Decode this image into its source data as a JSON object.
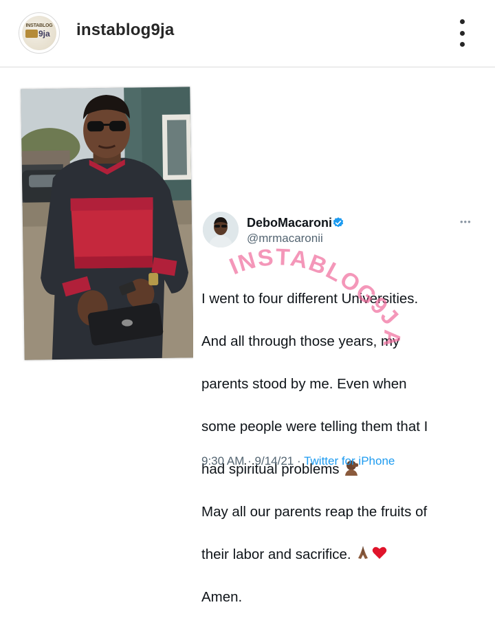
{
  "header": {
    "username": "instablog9ja",
    "avatar_logo_top": "INSTABLOG",
    "avatar_logo_num": "9ja",
    "more_icon": "more-vertical-icon"
  },
  "tweet": {
    "name": "DeboMacaroni",
    "handle": "@mrmacaronii",
    "verified_icon": "verified-badge-icon",
    "body_lines": [
      "I went to four different Universities.",
      "And all through those years, my",
      "parents stood by me. Even when",
      "some people were telling them that I",
      "had spiritual problems",
      "May all our parents reap the fruits of",
      "their labor and sacrifice.",
      "Amen."
    ],
    "time": "9:30 AM",
    "date": "9/14/21",
    "separator": "·",
    "source": "Twitter for iPhone"
  },
  "watermark": {
    "text": "INSTABLOG9JA",
    "color": "#f06b9b"
  },
  "colors": {
    "link": "#1d9bf0",
    "text": "#0f1419",
    "muted": "#536471"
  }
}
